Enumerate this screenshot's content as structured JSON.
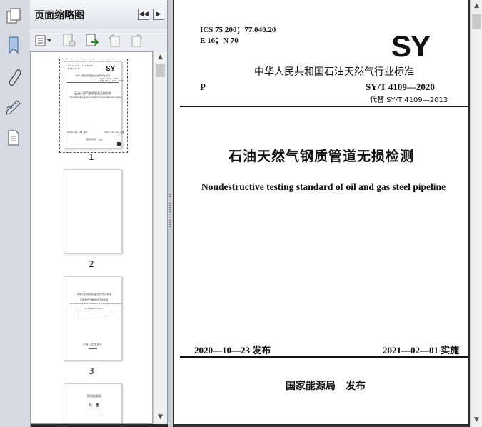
{
  "panel": {
    "title": "页面缩略图",
    "page_numbers": [
      "1",
      "2",
      "3"
    ]
  },
  "document": {
    "ics": "ICS 75.200；77.040.20",
    "code_line": "E 16；N 70",
    "logo": "SY",
    "standard_body": "中华人民共和国石油天然气行业标准",
    "classification": "P",
    "std_number": "SY/T 4109—2020",
    "replaces": "代替 SY/T 4109—2013",
    "title_cn": "石油天然气钢质管道无损检测",
    "title_en": "Nondestructive testing standard of oil and gas steel pipeline",
    "issue_date": "2020—10—23 发布",
    "effective_date": "2021—02—01 实施",
    "issuer": "国家能源局　发布"
  },
  "thumb3": {
    "mark": "石 油 工 业 出 版 社"
  },
  "thumb4": {
    "line1": "国家能源局",
    "line2": "公　告"
  },
  "icons": {
    "rail": [
      "pages-icon",
      "bookmark-icon",
      "attachment-icon",
      "signature-icon",
      "layers-icon"
    ],
    "toolbar": [
      "options-menu-icon",
      "delete-page-icon",
      "insert-page-icon",
      "rotate-left-icon",
      "rotate-right-icon"
    ]
  }
}
